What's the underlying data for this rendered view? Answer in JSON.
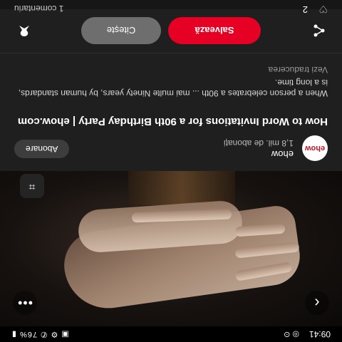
{
  "status_bar": {
    "time": "09:41",
    "left_icons": "◎ ⊙",
    "right_icons": "▣ ⚙ ✆ 76% ▮"
  },
  "photo": {
    "back_icon": "chevron-left-icon",
    "more_icon": "more-horizontal-icon",
    "lens_icon": "visual-search-icon"
  },
  "channel": {
    "name": "ehow",
    "subscribers": "1,8 mil. de abonați",
    "avatar_text": "ehow",
    "subscribe_label": "Abonare"
  },
  "pin": {
    "title": "How to Word Invitations for a 90th Birthday Party | ehow.com",
    "description": "When a person celebrates a 90th ... mai multe Ninety years, by human standards, is a long time.",
    "translate_label": "Vezi traducerea"
  },
  "actions": {
    "save_label": "Salvează",
    "visit_label": "Citește",
    "share_icon": "share-icon",
    "pin_icon": "pin-icon"
  },
  "engagement": {
    "reaction_count": "2",
    "comments_label": "1 comentariu"
  },
  "colors": {
    "accent": "#e60023",
    "background": "#1f1f1f"
  }
}
